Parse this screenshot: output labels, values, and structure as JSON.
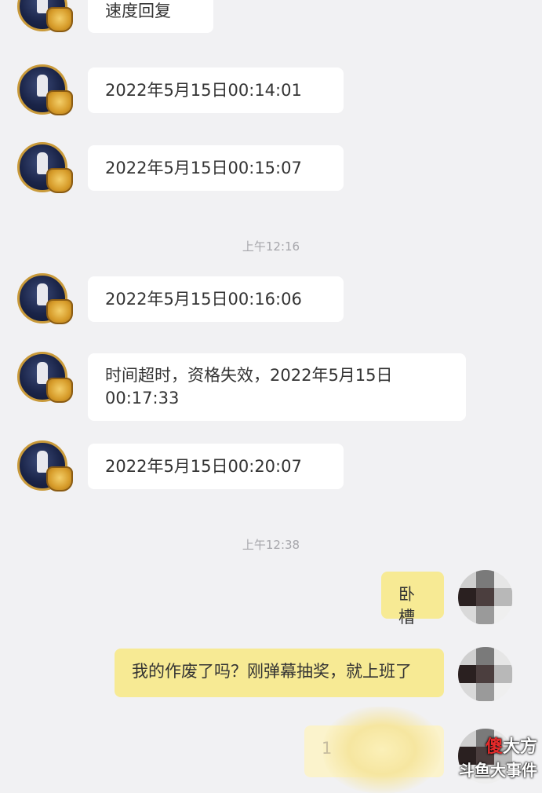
{
  "messages": [
    {
      "side": "left",
      "text": "速度回复"
    },
    {
      "side": "left",
      "text": "2022年5月15日00:14:01"
    },
    {
      "side": "left",
      "text": "2022年5月15日00:15:07"
    },
    {
      "side": "left",
      "text": "2022年5月15日00:16:06"
    },
    {
      "side": "left",
      "text": "时间超时，资格失效，2022年5月15日\n00:17:33"
    },
    {
      "side": "left",
      "text": "2022年5月15日00:20:07"
    },
    {
      "side": "right",
      "text": "卧槽"
    },
    {
      "side": "right",
      "text": "我的作废了吗？刚弹幕抽奖，就上班了"
    },
    {
      "side": "right",
      "text": "1"
    }
  ],
  "timestamps": [
    "上午12:16",
    "上午12:38"
  ],
  "watermark": {
    "top_red": "傻",
    "top_rest": "大方",
    "bottom": "斗鱼大事件"
  },
  "colors": {
    "background": "#f1f1f3",
    "bubble_left": "#ffffff",
    "bubble_right": "#f7ea94",
    "timestamp": "#a6a6ab"
  }
}
